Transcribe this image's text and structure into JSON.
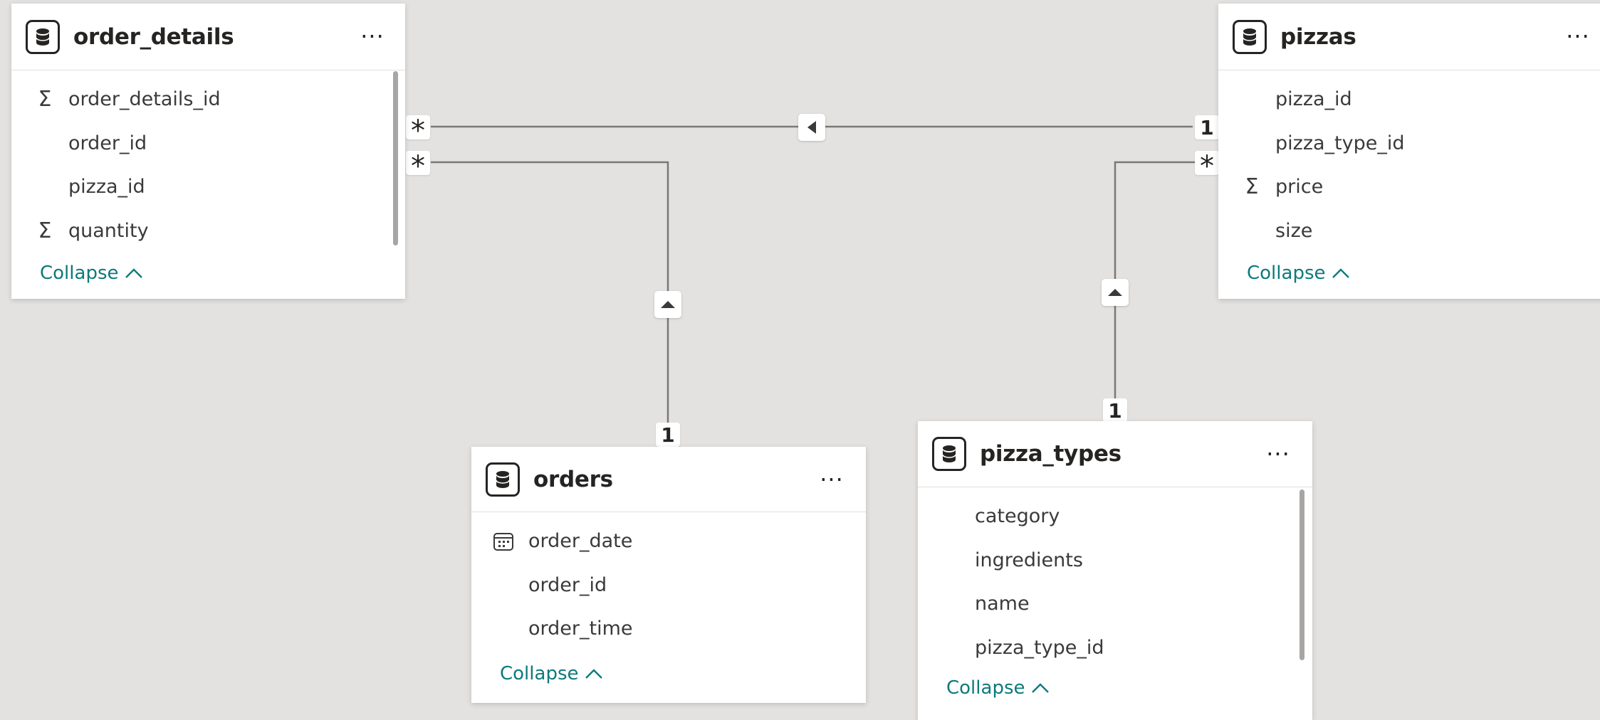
{
  "tables": {
    "order_details": {
      "name": "order_details",
      "more": "···",
      "fields": [
        {
          "label": "order_details_id",
          "icon": "sum-icon",
          "glyph": "Σ"
        },
        {
          "label": "order_id",
          "icon": "",
          "glyph": ""
        },
        {
          "label": "pizza_id",
          "icon": "",
          "glyph": ""
        },
        {
          "label": "quantity",
          "icon": "sum-icon",
          "glyph": "Σ"
        }
      ],
      "collapse": "Collapse"
    },
    "pizzas": {
      "name": "pizzas",
      "more": "···",
      "fields": [
        {
          "label": "pizza_id",
          "icon": "",
          "glyph": ""
        },
        {
          "label": "pizza_type_id",
          "icon": "",
          "glyph": ""
        },
        {
          "label": "price",
          "icon": "sum-icon",
          "glyph": "Σ"
        },
        {
          "label": "size",
          "icon": "",
          "glyph": ""
        }
      ],
      "collapse": "Collapse"
    },
    "orders": {
      "name": "orders",
      "more": "···",
      "fields": [
        {
          "label": "order_date",
          "icon": "calendar-icon",
          "glyph": ""
        },
        {
          "label": "order_id",
          "icon": "",
          "glyph": ""
        },
        {
          "label": "order_time",
          "icon": "",
          "glyph": ""
        }
      ],
      "collapse": "Collapse"
    },
    "pizza_types": {
      "name": "pizza_types",
      "more": "···",
      "fields": [
        {
          "label": "category",
          "icon": "",
          "glyph": ""
        },
        {
          "label": "ingredients",
          "icon": "",
          "glyph": ""
        },
        {
          "label": "name",
          "icon": "",
          "glyph": ""
        },
        {
          "label": "pizza_type_id",
          "icon": "",
          "glyph": ""
        }
      ],
      "collapse": "Collapse"
    }
  },
  "relationships": [
    {
      "from": "order_details",
      "to": "pizzas",
      "from_cardinality": "*",
      "to_cardinality": "1",
      "filter_direction": "left"
    },
    {
      "from": "order_details",
      "to": "orders",
      "from_cardinality": "*",
      "to_cardinality": "1",
      "filter_direction": "up"
    },
    {
      "from": "pizzas",
      "to": "pizza_types",
      "from_cardinality": "*",
      "to_cardinality": "1",
      "filter_direction": "up"
    }
  ],
  "colors": {
    "canvas": "#e4e2e0",
    "line": "#7a7876",
    "link_text": "#0e7a7a"
  }
}
